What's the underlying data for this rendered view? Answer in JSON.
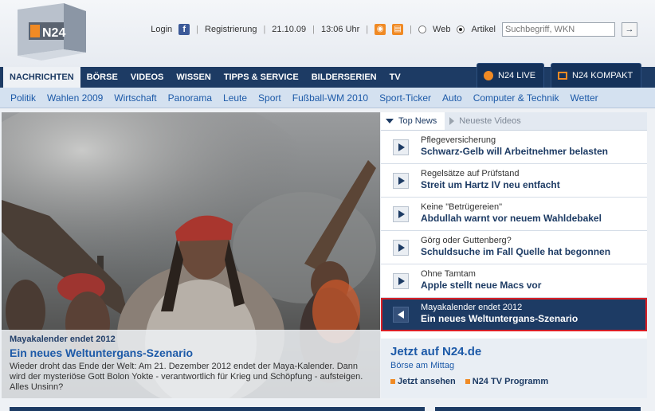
{
  "header": {
    "logo_text": "N24",
    "login": "Login",
    "registrierung": "Registrierung",
    "date": "21.10.09",
    "time": "13:06 Uhr",
    "web_label": "Web",
    "artikel_label": "Artikel",
    "search_placeholder": "Suchbegriff, WKN",
    "search_go": "→"
  },
  "main_nav": {
    "items": [
      "NACHRICHTEN",
      "BÖRSE",
      "VIDEOS",
      "WISSEN",
      "TIPPS & SERVICE",
      "BILDERSERIEN",
      "TV"
    ],
    "live_label": "N24 LIVE",
    "kompakt_label": "N24 KOMPAKT"
  },
  "sub_nav": {
    "items": [
      "Politik",
      "Wahlen 2009",
      "Wirtschaft",
      "Panorama",
      "Leute",
      "Sport",
      "Fußball-WM 2010",
      "Sport-Ticker",
      "Auto",
      "Computer & Technik",
      "Wetter"
    ]
  },
  "hero": {
    "kicker": "Mayakalender endet 2012",
    "title": "Ein neues Weltuntergans-Szenario",
    "text": "Wieder droht das Ende der Welt: Am 21. Dezember 2012 endet der Maya-Kalender. Dann wird der mysteriöse Gott Bolon Yokte - verantwortlich für Krieg und Schöpfung - aufsteigen. Alles Unsinn?"
  },
  "panel": {
    "tab_top": "Top News",
    "tab_videos": "Neueste Videos",
    "items": [
      {
        "kicker": "Pflegeversicherung",
        "title": "Schwarz-Gelb will Arbeitnehmer belasten"
      },
      {
        "kicker": "Regelsätze auf Prüfstand",
        "title": "Streit um Hartz IV neu entfacht"
      },
      {
        "kicker": "Keine \"Betrügereien\"",
        "title": "Abdullah warnt vor neuem Wahldebakel"
      },
      {
        "kicker": "Görg oder Guttenberg?",
        "title": "Schuldsuche im Fall Quelle hat begonnen"
      },
      {
        "kicker": "Ohne Tamtam",
        "title": "Apple stellt neue Macs vor"
      },
      {
        "kicker": "Mayakalender endet 2012",
        "title": "Ein neues Weltuntergans-Szenario"
      }
    ]
  },
  "tv": {
    "title": "Jetzt auf N24.de",
    "subtitle": "Börse am Mittag",
    "link1": "Jetzt ansehen",
    "link2": "N24 TV Programm"
  },
  "colors": {
    "nav_dark": "#1d3b64",
    "link_blue": "#1d5aa8",
    "accent_orange": "#f08a24",
    "highlight_red": "#d91f26"
  }
}
